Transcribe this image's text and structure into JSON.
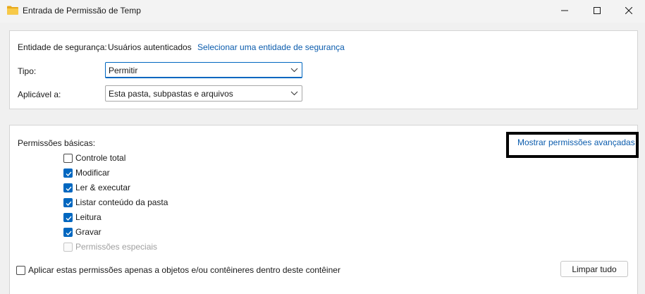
{
  "window": {
    "title": "Entrada de Permissão de Temp",
    "icon": "folder-icon",
    "controls": [
      "minimize-icon",
      "maximize-icon",
      "close-icon"
    ]
  },
  "principal": {
    "label": "Entidade de segurança:",
    "value": "Usuários autenticados",
    "select_link": "Selecionar uma entidade de segurança"
  },
  "type": {
    "label": "Tipo:",
    "value": "Permitir"
  },
  "applies_to": {
    "label": "Aplicável a:",
    "value": "Esta pasta, subpastas e arquivos"
  },
  "basic_permissions": {
    "heading": "Permissões básicas:",
    "advanced_link": "Mostrar permissões avançadas",
    "items": [
      {
        "label": "Controle total",
        "checked": false,
        "disabled": false
      },
      {
        "label": "Modificar",
        "checked": true,
        "disabled": false
      },
      {
        "label": "Ler & executar",
        "checked": true,
        "disabled": false
      },
      {
        "label": "Listar conteúdo da pasta",
        "checked": true,
        "disabled": false
      },
      {
        "label": "Leitura",
        "checked": true,
        "disabled": false
      },
      {
        "label": "Gravar",
        "checked": true,
        "disabled": false
      },
      {
        "label": "Permissões especiais",
        "checked": false,
        "disabled": true
      }
    ]
  },
  "apply_only": {
    "label": "Aplicar estas permissões apenas a objetos e/ou contêineres dentro deste contêiner",
    "checked": false
  },
  "clear_all_button": "Limpar tudo",
  "colors": {
    "accent": "#0067c0",
    "link": "#0b5cad",
    "highlight": "#000000"
  }
}
